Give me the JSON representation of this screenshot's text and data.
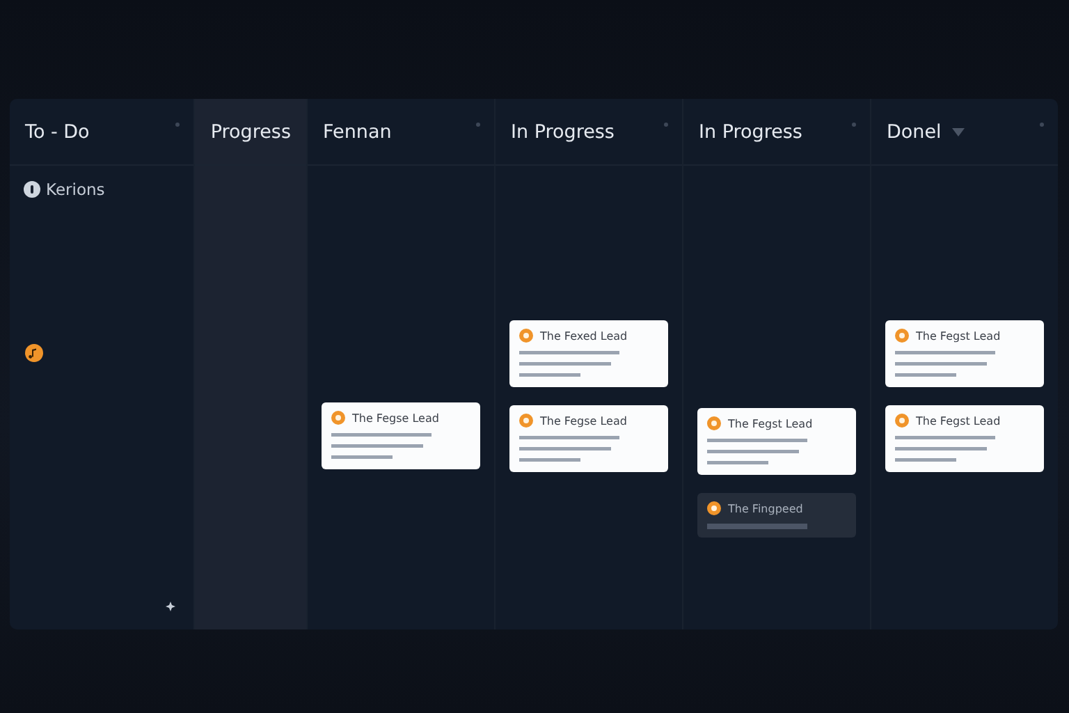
{
  "columns": [
    {
      "title": "To - Do",
      "highlighted": false,
      "caret": false,
      "label": "Kerions"
    },
    {
      "title": "Progress",
      "highlighted": true,
      "caret": false
    },
    {
      "title": "Fennan",
      "highlighted": false,
      "caret": false,
      "cards": [
        {
          "title": "The Fegse Lead",
          "dimmed": false
        }
      ]
    },
    {
      "title": "In Progress",
      "highlighted": false,
      "caret": false,
      "cards": [
        {
          "title": "The Fexed Lead",
          "dimmed": false
        },
        {
          "title": "The Fegse Lead",
          "dimmed": false
        }
      ]
    },
    {
      "title": "In Progress",
      "highlighted": false,
      "caret": false,
      "cards": [
        {
          "title": "The Fegst Lead",
          "dimmed": false
        },
        {
          "title": "The Fingpeed",
          "dimmed": true
        }
      ]
    },
    {
      "title": "Donel",
      "highlighted": false,
      "caret": true,
      "cards": [
        {
          "title": "The Fegst Lead",
          "dimmed": false
        },
        {
          "title": "The Fegst Lead",
          "dimmed": false
        }
      ]
    }
  ]
}
